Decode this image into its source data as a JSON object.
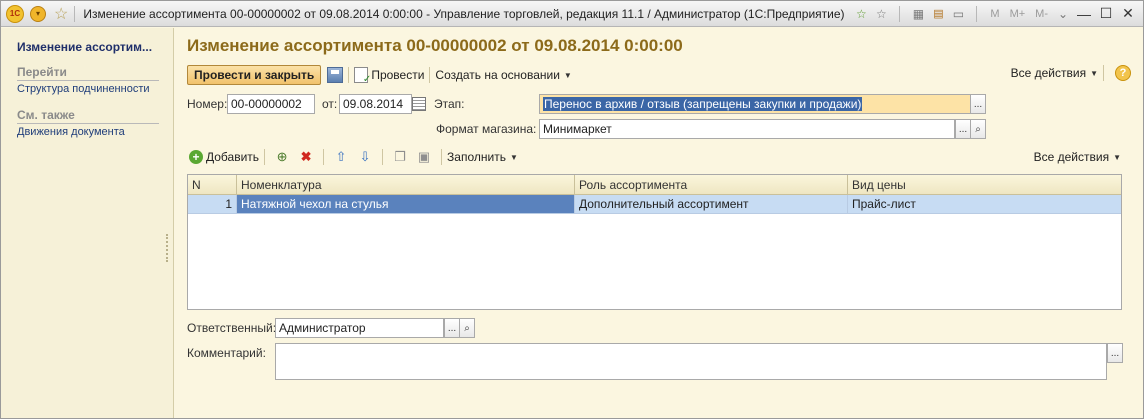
{
  "titlebar": {
    "title": "Изменение ассортимента 00-00000002 от 09.08.2014 0:00:00 - Управление торговлей, редакция 11.1 / Администратор  (1С:Предприятие)",
    "m_labels": [
      "M",
      "M+",
      "M-"
    ]
  },
  "sidebar": {
    "title": "Изменение ассортим...",
    "group_goto": "Перейти",
    "link_structure": "Структура подчиненности",
    "group_see_also": "См. также",
    "link_movements": "Движения документа"
  },
  "main": {
    "title": "Изменение ассортимента 00-00000002 от 09.08.2014 0:00:00",
    "toolbar": {
      "post_close": "Провести и закрыть",
      "post": "Провести",
      "create_based": "Создать на основании",
      "all_actions": "Все действия",
      "help": "?"
    },
    "form": {
      "number_label": "Номер:",
      "number_value": "00-00000002",
      "date_label": "от:",
      "date_value": "09.08.2014",
      "stage_label": "Этап:",
      "stage_value": "Перенос в архив / отзыв (запрещены закупки и продажи)",
      "format_label": "Формат магазина:",
      "format_value": "Минимаркет",
      "responsible_label": "Ответственный:",
      "responsible_value": "Администратор",
      "comment_label": "Комментарий:",
      "comment_value": "",
      "ellipsis": "...",
      "search": "⌕"
    },
    "table_toolbar": {
      "add": "Добавить",
      "fill": "Заполнить",
      "all_actions": "Все действия"
    },
    "table": {
      "columns": [
        "N",
        "Номенклатура",
        "Роль ассортимента",
        "Вид цены"
      ],
      "rows": [
        {
          "n": "1",
          "item": "Натяжной чехол на стулья",
          "role": "Дополнительный ассортимент",
          "price_type": "Прайс-лист"
        }
      ]
    }
  }
}
